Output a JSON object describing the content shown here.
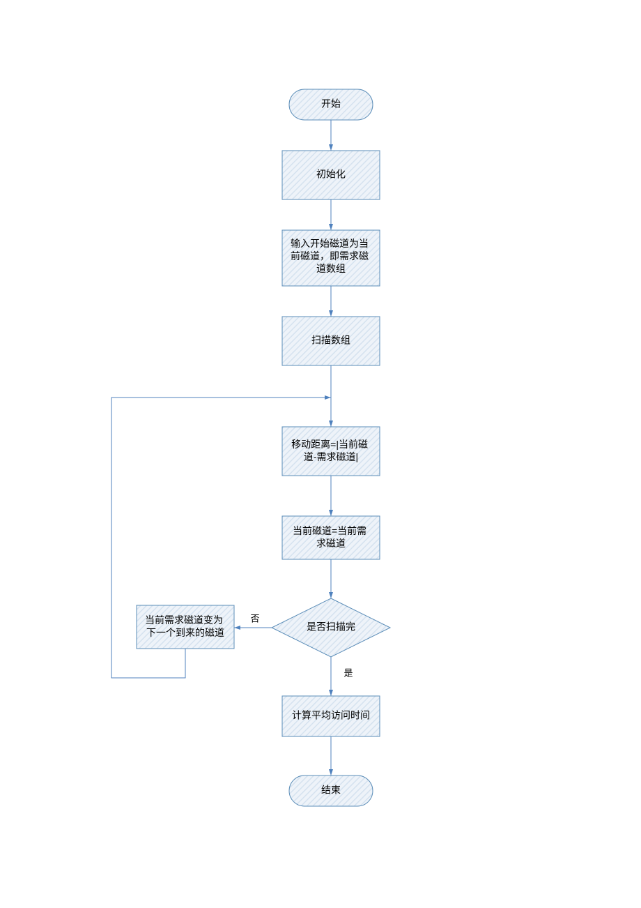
{
  "chart_data": {
    "type": "flowchart",
    "nodes": [
      {
        "id": "start",
        "shape": "terminator",
        "text_lines": [
          "开始"
        ]
      },
      {
        "id": "init",
        "shape": "process",
        "text_lines": [
          "初始化"
        ]
      },
      {
        "id": "input",
        "shape": "process",
        "text_lines": [
          "输入开始磁道为当",
          "前磁道，即需求磁",
          "道数组"
        ]
      },
      {
        "id": "scan",
        "shape": "process",
        "text_lines": [
          "扫描数组"
        ]
      },
      {
        "id": "dist",
        "shape": "process",
        "text_lines": [
          "移动距离=|当前磁",
          "道-需求磁道|"
        ]
      },
      {
        "id": "assign",
        "shape": "process",
        "text_lines": [
          "当前磁道=当前需",
          "求磁道"
        ]
      },
      {
        "id": "decide",
        "shape": "decision",
        "text_lines": [
          "是否扫描完"
        ]
      },
      {
        "id": "next",
        "shape": "process",
        "text_lines": [
          "当前需求磁道变为",
          "下一个到来的磁道"
        ]
      },
      {
        "id": "avg",
        "shape": "process",
        "text_lines": [
          "计算平均访问时间"
        ]
      },
      {
        "id": "end",
        "shape": "terminator",
        "text_lines": [
          "结束"
        ]
      }
    ],
    "edges": [
      {
        "from": "start",
        "to": "init",
        "label": ""
      },
      {
        "from": "init",
        "to": "input",
        "label": ""
      },
      {
        "from": "input",
        "to": "scan",
        "label": ""
      },
      {
        "from": "scan",
        "to": "dist",
        "label": ""
      },
      {
        "from": "dist",
        "to": "assign",
        "label": ""
      },
      {
        "from": "assign",
        "to": "decide",
        "label": ""
      },
      {
        "from": "decide",
        "to": "avg",
        "label": "是"
      },
      {
        "from": "decide",
        "to": "next",
        "label": "否"
      },
      {
        "from": "next",
        "to": "dist",
        "label": "",
        "note": "loop back"
      },
      {
        "from": "avg",
        "to": "end",
        "label": ""
      }
    ]
  },
  "edge_labels": {
    "yes": "是",
    "no": "否"
  }
}
